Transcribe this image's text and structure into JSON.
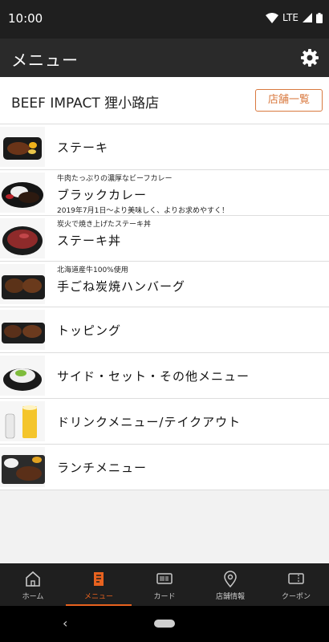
{
  "status_bar": {
    "time": "10:00",
    "network": "LTE"
  },
  "app_bar": {
    "title": "メニュー",
    "settings_icon": "gear-icon"
  },
  "store": {
    "name": "BEEF IMPACT 狸小路店",
    "list_button": "店舗一覧"
  },
  "menu": [
    {
      "label": "ステーキ",
      "sub": "",
      "note": ""
    },
    {
      "label": "ブラックカレー",
      "sub": "牛肉たっぷりの濃厚なビーフカレー",
      "note": "2019年7月1日〜より美味しく、よりお求めやすく！"
    },
    {
      "label": "ステーキ丼",
      "sub": "炭火で焼き上げたステーキ丼",
      "note": ""
    },
    {
      "label": "手ごね炭焼ハンバーグ",
      "sub": "北海道産牛100%使用",
      "note": ""
    },
    {
      "label": "トッピング",
      "sub": "",
      "note": ""
    },
    {
      "label": "サイド・セット・その他メニュー",
      "sub": "",
      "note": ""
    },
    {
      "label": "ドリンクメニュー/テイクアウト",
      "sub": "",
      "note": ""
    },
    {
      "label": "ランチメニュー",
      "sub": "",
      "note": ""
    }
  ],
  "bottom_nav": [
    {
      "label": "ホーム",
      "icon": "home-icon",
      "active": false
    },
    {
      "label": "メニュー",
      "icon": "menu-book-icon",
      "active": true
    },
    {
      "label": "カード",
      "icon": "card-icon",
      "active": false
    },
    {
      "label": "店舗情報",
      "icon": "location-pin-icon",
      "active": false
    },
    {
      "label": "クーポン",
      "icon": "coupon-icon",
      "active": false
    }
  ],
  "colors": {
    "accent": "#e8621f",
    "store_button": "#d9793f",
    "bar": "#2a2a2a"
  }
}
